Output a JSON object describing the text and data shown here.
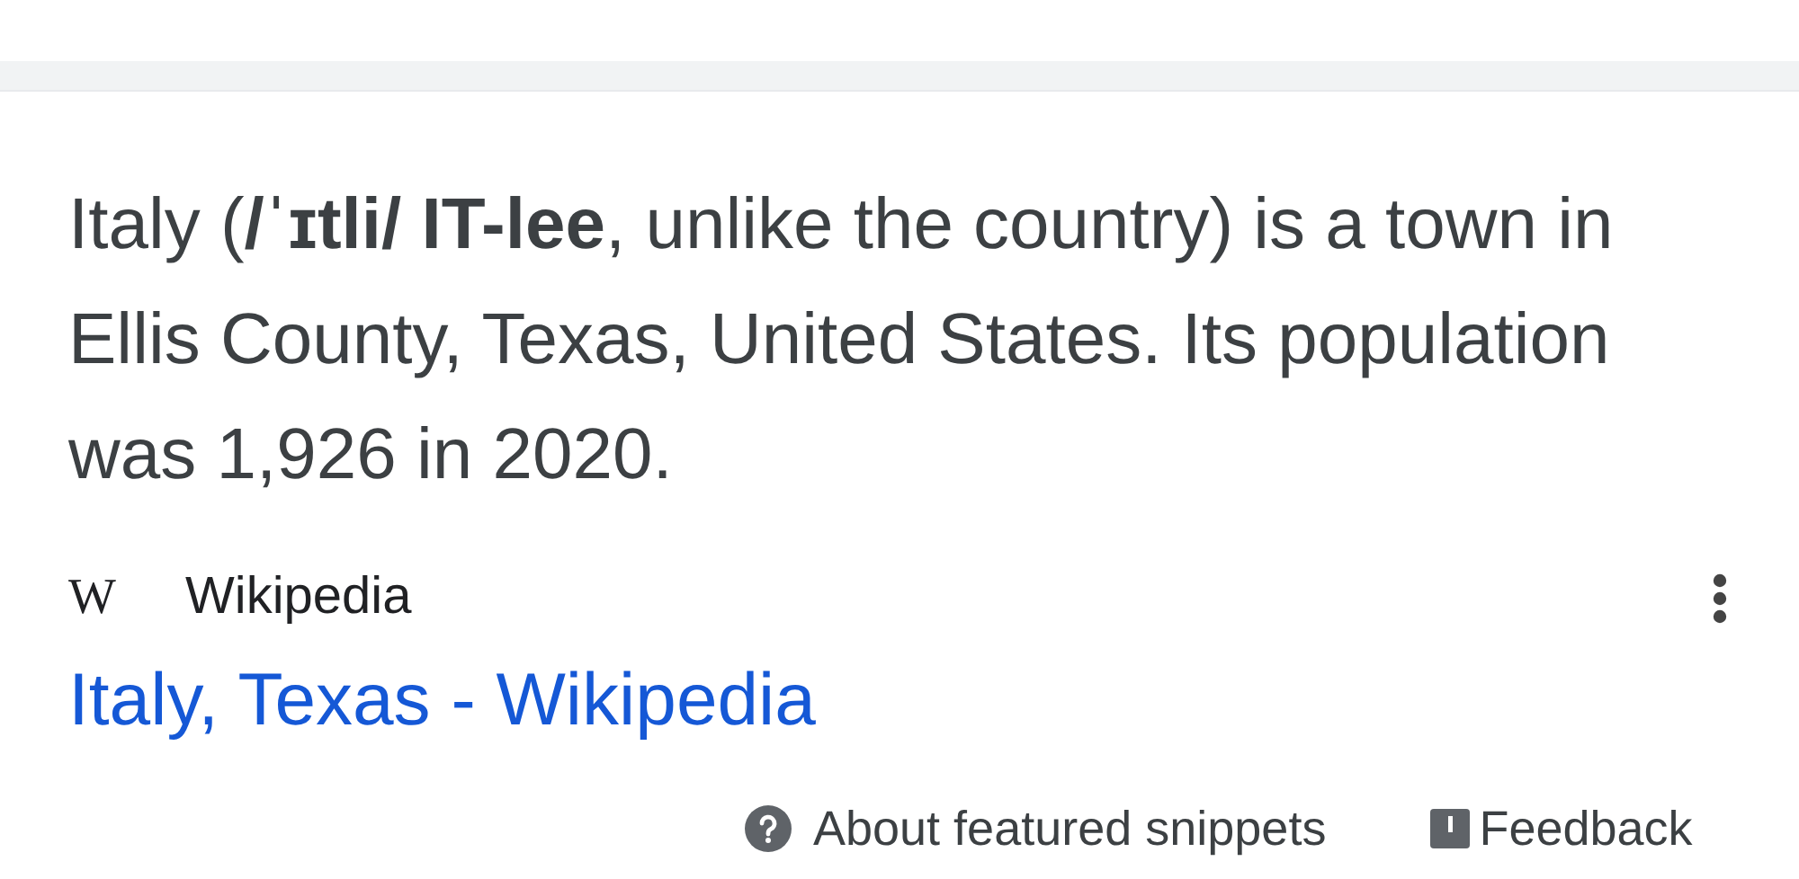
{
  "snippet": {
    "text": "Italy (**/ˈɪtli/ IT-lee**, unlike the country) is a town in Ellis County, Texas, United States. Its population was 1,926 in 2020."
  },
  "source": {
    "name": "Wikipedia",
    "icon_letter": "W"
  },
  "result_link": "Italy, Texas - Wikipedia",
  "footer": {
    "about": "About featured snippets",
    "feedback": "Feedback"
  }
}
